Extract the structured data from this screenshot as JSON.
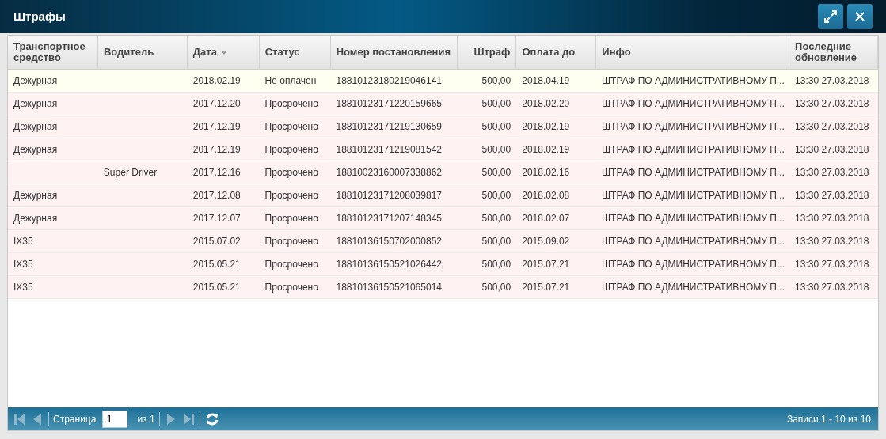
{
  "window": {
    "title": "Штрафы"
  },
  "columns": [
    {
      "label": "Транспортное средство",
      "sorted": false
    },
    {
      "label": "Водитель",
      "sorted": false
    },
    {
      "label": "Дата",
      "sorted": true
    },
    {
      "label": "Статус",
      "sorted": false
    },
    {
      "label": "Номер постановления",
      "sorted": false
    },
    {
      "label": "Штраф",
      "sorted": false
    },
    {
      "label": "Оплата до",
      "sorted": false
    },
    {
      "label": "Инфо",
      "sorted": false
    },
    {
      "label": "Последние обновление",
      "sorted": false
    }
  ],
  "rows": [
    {
      "color": "#fefff0",
      "cells": [
        "Дежурная",
        "",
        "2018.02.19",
        "Не оплачен",
        "18810123180219046141",
        "500,00",
        "2018.04.19",
        "ШТРАФ ПО АДМИНИСТРАТИВНОМУ П...",
        "13:30 27.03.2018"
      ]
    },
    {
      "color": "#fff2f2",
      "cells": [
        "Дежурная",
        "",
        "2017.12.20",
        "Просрочено",
        "18810123171220159665",
        "500,00",
        "2018.02.20",
        "ШТРАФ ПО АДМИНИСТРАТИВНОМУ П...",
        "13:30 27.03.2018"
      ]
    },
    {
      "color": "#fff2f2",
      "cells": [
        "Дежурная",
        "",
        "2017.12.19",
        "Просрочено",
        "18810123171219130659",
        "500,00",
        "2018.02.19",
        "ШТРАФ ПО АДМИНИСТРАТИВНОМУ П...",
        "13:30 27.03.2018"
      ]
    },
    {
      "color": "#fff2f2",
      "cells": [
        "Дежурная",
        "",
        "2017.12.19",
        "Просрочено",
        "18810123171219081542",
        "500,00",
        "2018.02.19",
        "ШТРАФ ПО АДМИНИСТРАТИВНОМУ П...",
        "13:30 27.03.2018"
      ]
    },
    {
      "color": "#fff2f2",
      "cells": [
        "",
        "Super Driver",
        "2017.12.16",
        "Просрочено",
        "18810023160007338862",
        "500,00",
        "2018.02.16",
        "ШТРАФ ПО АДМИНИСТРАТИВНОМУ П...",
        "13:30 27.03.2018"
      ]
    },
    {
      "color": "#fff2f2",
      "cells": [
        "Дежурная",
        "",
        "2017.12.08",
        "Просрочено",
        "18810123171208039817",
        "500,00",
        "2018.02.08",
        "ШТРАФ ПО АДМИНИСТРАТИВНОМУ П...",
        "13:30 27.03.2018"
      ]
    },
    {
      "color": "#fff2f2",
      "cells": [
        "Дежурная",
        "",
        "2017.12.07",
        "Просрочено",
        "18810123171207148345",
        "500,00",
        "2018.02.07",
        "ШТРАФ ПО АДМИНИСТРАТИВНОМУ П...",
        "13:30 27.03.2018"
      ]
    },
    {
      "color": "#fff2f2",
      "cells": [
        "IX35",
        "",
        "2015.07.02",
        "Просрочено",
        "18810136150702000852",
        "500,00",
        "2015.09.02",
        "ШТРАФ ПО АДМИНИСТРАТИВНОМУ П...",
        "13:30 27.03.2018"
      ]
    },
    {
      "color": "#fff2f2",
      "cells": [
        "IX35",
        "",
        "2015.05.21",
        "Просрочено",
        "18810136150521026442",
        "500,00",
        "2015.07.21",
        "ШТРАФ ПО АДМИНИСТРАТИВНОМУ П...",
        "13:30 27.03.2018"
      ]
    },
    {
      "color": "#fff2f2",
      "cells": [
        "IX35",
        "",
        "2015.05.21",
        "Просрочено",
        "18810136150521065014",
        "500,00",
        "2015.07.21",
        "ШТРАФ ПО АДМИНИСТРАТИВНОМУ П...",
        "13:30 27.03.2018"
      ]
    }
  ],
  "pager": {
    "first_disabled": true,
    "prev_disabled": true,
    "page_label": "Страница",
    "page_value": "1",
    "of_label": "из 1",
    "next_disabled": true,
    "last_disabled": true,
    "summary": "Записи 1 - 10 из 10"
  }
}
